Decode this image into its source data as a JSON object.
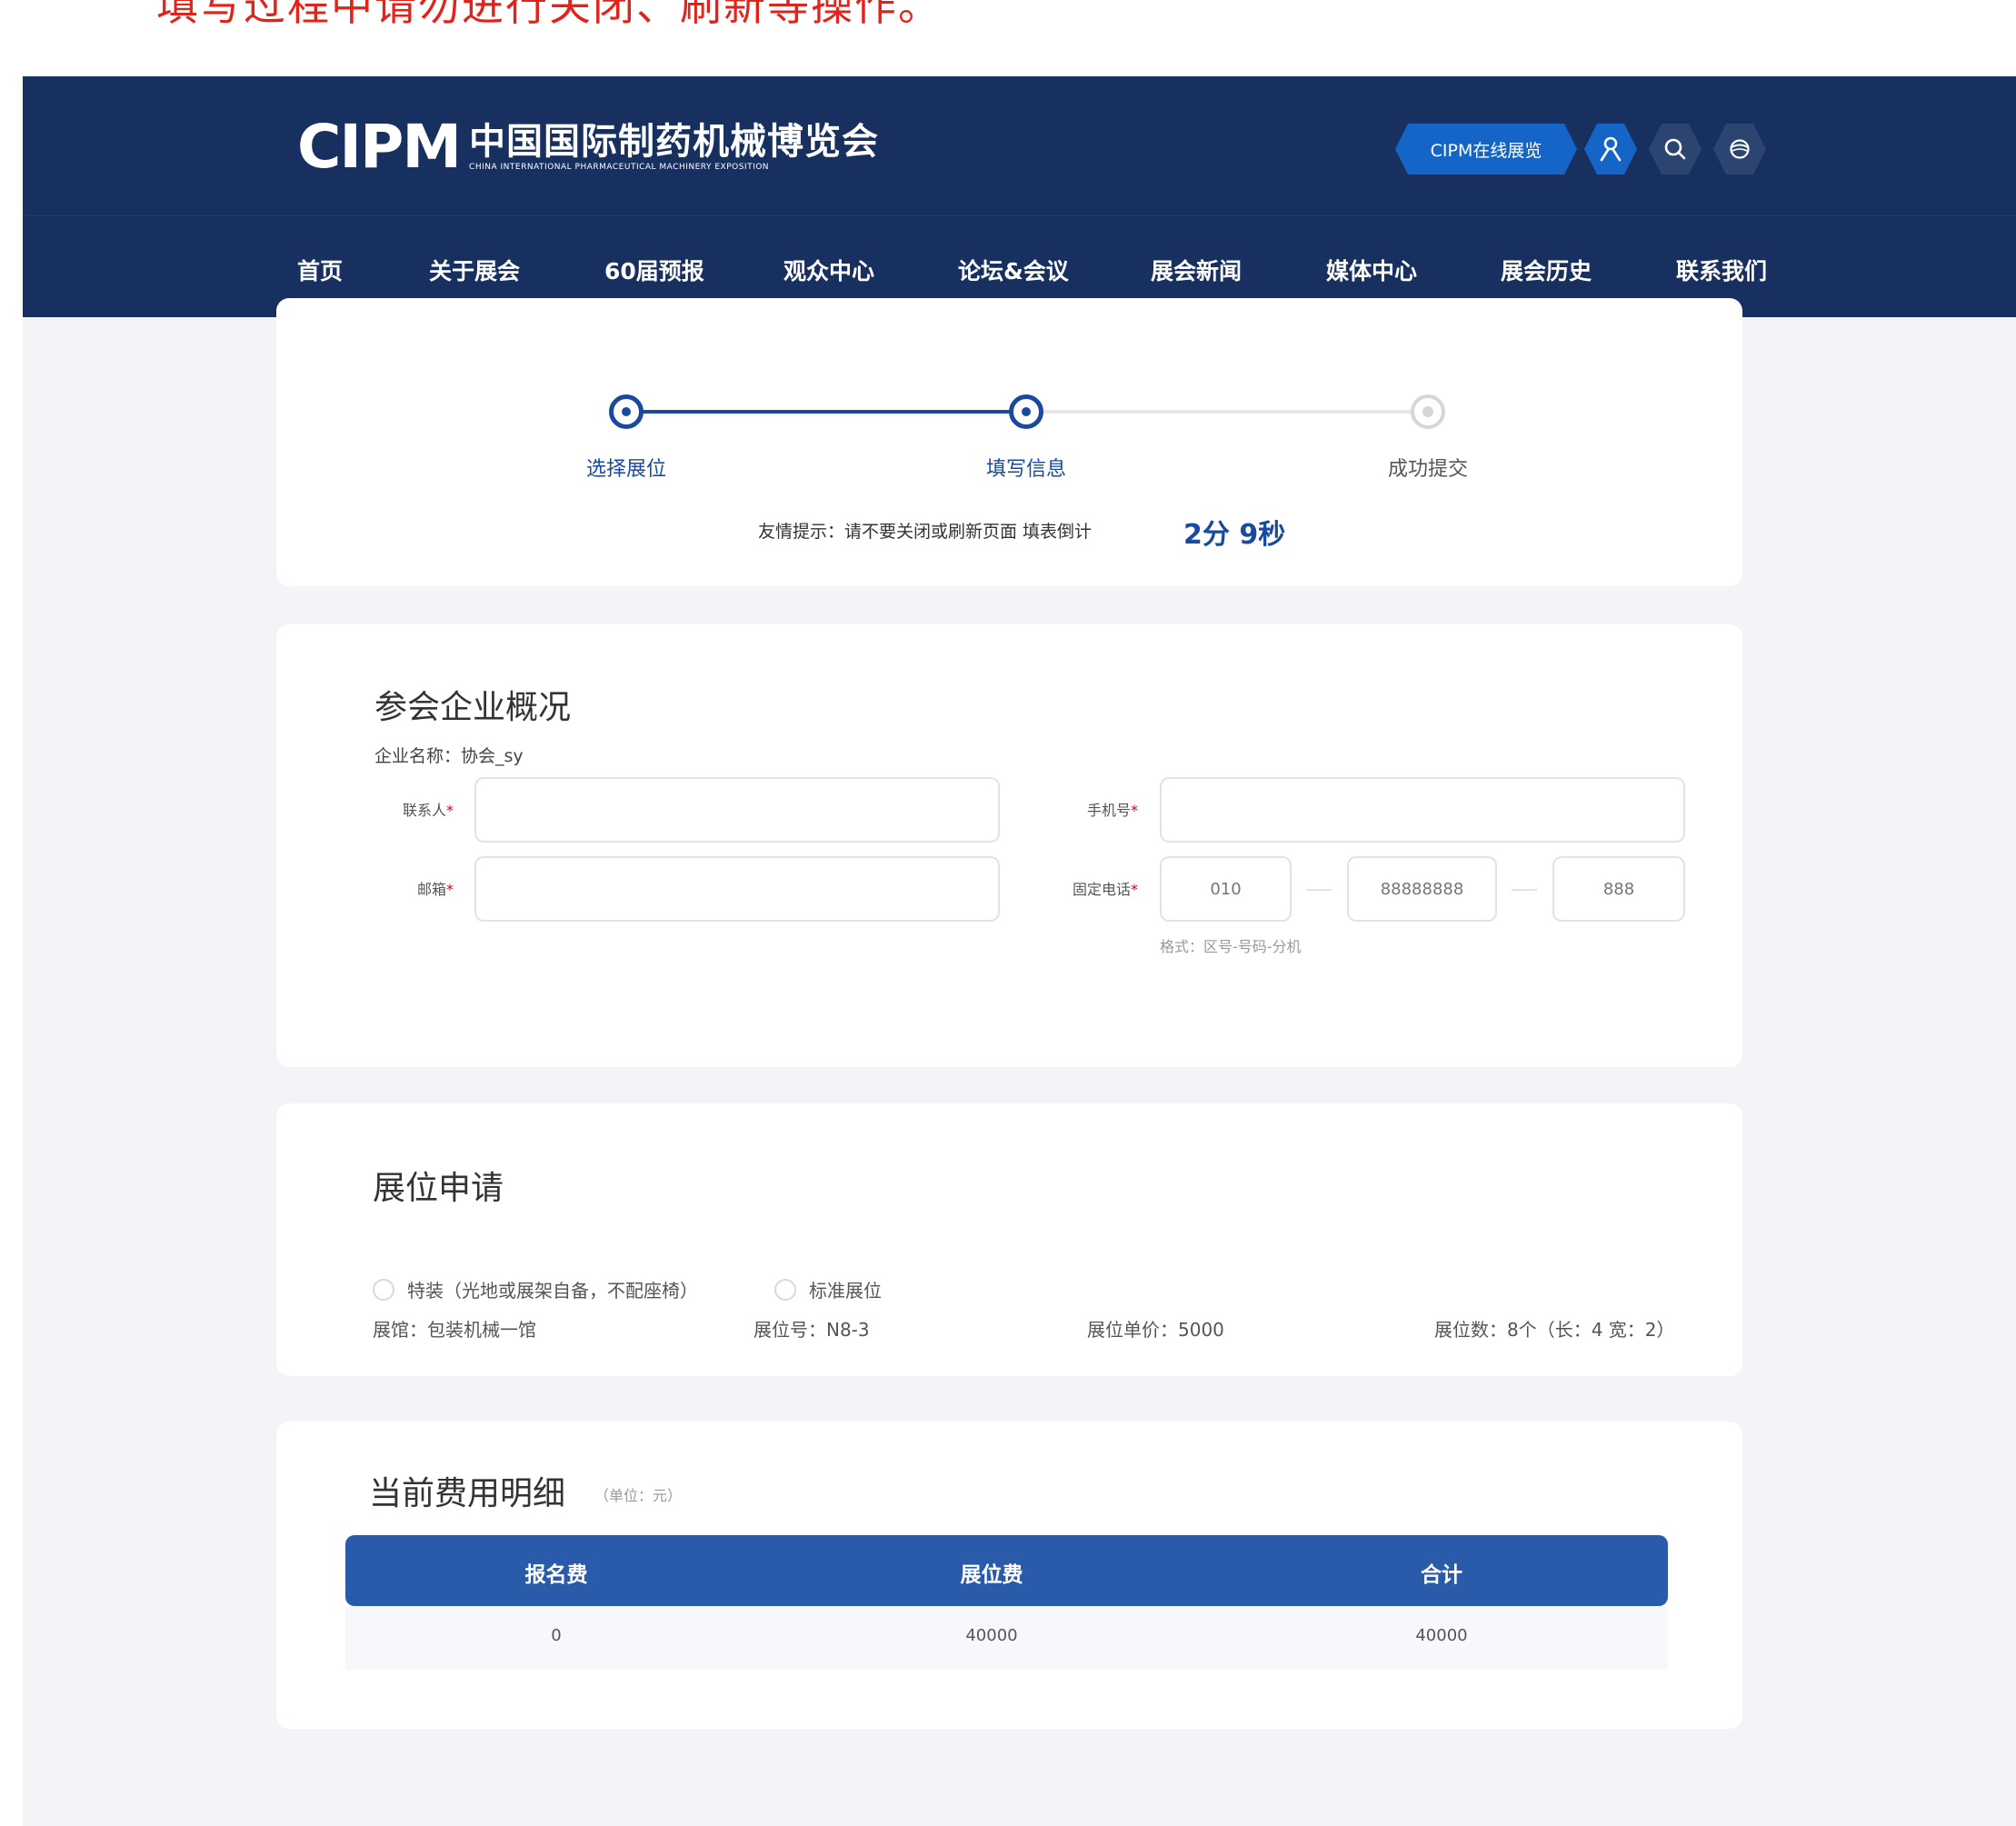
{
  "notice": "填写过程中请勿进行关闭、刷新等操作。",
  "header": {
    "logo_mark": "CIPM",
    "logo_cn": "中国国际制药机械博览会",
    "logo_en": "CHINA INTERNATIONAL PHARMACEUTICAL MACHINERY EXPOSITION",
    "online_button": "CIPM在线展览"
  },
  "nav": [
    "首页",
    "关于展会",
    "60届预报",
    "观众中心",
    "论坛&会议",
    "展会新闻",
    "媒体中心",
    "展会历史",
    "联系我们"
  ],
  "steps": {
    "items": [
      "选择展位",
      "填写信息",
      "成功提交"
    ],
    "current": 2,
    "tip": "友情提示：请不要关闭或刷新页面 填表倒计",
    "countdown": "2分 9秒"
  },
  "company": {
    "title": "参会企业概况",
    "name_line": "企业名称：协会_sy",
    "contact_label": "联系人",
    "mobile_label": "手机号",
    "email_label": "邮箱",
    "phone_label": "固定电话",
    "required_mark": "*",
    "contact_value": "",
    "mobile_value": "",
    "email_value": "",
    "area_code_placeholder": "010",
    "number_placeholder": "88888888",
    "ext_placeholder": "888",
    "phone_hint": "格式：区号-号码-分机"
  },
  "booth": {
    "title": "展位申请",
    "hall": "展馆：包装机械一馆",
    "booth_no": "展位号：N8-3",
    "unit_price": "展位单价：5000",
    "count": "展位数：8个（长：4 宽：2）",
    "option_special": "特装（光地或展架自备，不配座椅）",
    "option_standard": "标准展位"
  },
  "fees": {
    "title": "当前费用明细",
    "unit": "（单位：元）",
    "headers": [
      "报名费",
      "展位费",
      "合计"
    ],
    "row": [
      "0",
      "40000",
      "40000"
    ]
  },
  "colors": {
    "header_bg": "#17305f",
    "accent": "#1a4a9c",
    "table_head": "#2a5bab",
    "notice_red": "#e0241b"
  }
}
